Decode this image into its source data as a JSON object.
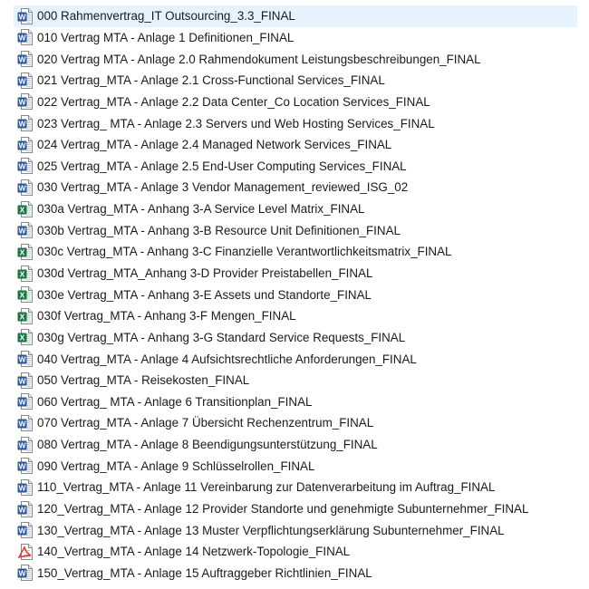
{
  "files": [
    {
      "name": "000 Rahmenvertrag_IT Outsourcing_3.3_FINAL",
      "type": "word",
      "icon": "word-document-icon",
      "selected": true
    },
    {
      "name": "010 Vertrag MTA - Anlage 1 Definitionen_FINAL",
      "type": "word",
      "icon": "word-document-icon"
    },
    {
      "name": "020 Vertrag MTA - Anlage 2.0 Rahmendokument Leistungsbeschreibungen_FINAL",
      "type": "word",
      "icon": "word-document-icon"
    },
    {
      "name": "021 Vertrag_MTA - Anlage 2.1 Cross-Functional Services_FINAL",
      "type": "word",
      "icon": "word-document-icon"
    },
    {
      "name": "022 Vertrag_MTA - Anlage 2.2 Data Center_Co Location Services_FINAL",
      "type": "word",
      "icon": "word-document-icon"
    },
    {
      "name": "023 Vertrag_ MTA - Anlage 2.3 Servers und Web Hosting Services_FINAL",
      "type": "word",
      "icon": "word-document-icon"
    },
    {
      "name": "024 Vertrag_MTA - Anlage 2.4 Managed Network Services_FINAL",
      "type": "word",
      "icon": "word-document-icon"
    },
    {
      "name": "025 Vertrag_MTA - Anlage 2.5 End-User Computing Services_FINAL",
      "type": "word",
      "icon": "word-document-icon"
    },
    {
      "name": "030 Vertrag_MTA - Anlage 3 Vendor Management_reviewed_ISG_02",
      "type": "word",
      "icon": "word-document-icon"
    },
    {
      "name": "030a Vertrag_MTA - Anhang 3-A Service Level Matrix_FINAL",
      "type": "excel",
      "icon": "excel-spreadsheet-icon"
    },
    {
      "name": "030b Vertrag_MTA - Anhang 3-B Resource Unit Definitionen_FINAL",
      "type": "word",
      "icon": "word-document-icon"
    },
    {
      "name": "030c Vertrag_MTA - Anhang 3-C Finanzielle Verantwortlichkeitsmatrix_FINAL",
      "type": "excel",
      "icon": "excel-spreadsheet-icon"
    },
    {
      "name": "030d Vertrag_MTA_Anhang 3-D Provider Preistabellen_FINAL",
      "type": "excel",
      "icon": "excel-spreadsheet-icon"
    },
    {
      "name": "030e Vertrag_MTA - Anhang 3-E Assets und Standorte_FINAL",
      "type": "excel",
      "icon": "excel-spreadsheet-icon"
    },
    {
      "name": "030f Vertrag_MTA - Anhang 3-F Mengen_FINAL",
      "type": "excel",
      "icon": "excel-spreadsheet-icon"
    },
    {
      "name": "030g Vertrag_MTA - Anhang 3-G Standard Service Requests_FINAL",
      "type": "excel",
      "icon": "excel-spreadsheet-icon"
    },
    {
      "name": "040 Vertrag_MTA - Anlage 4 Aufsichtsrechtliche Anforderungen_FINAL",
      "type": "word",
      "icon": "word-document-icon"
    },
    {
      "name": "050 Vertrag_MTA - Reisekosten_FINAL",
      "type": "word",
      "icon": "word-document-icon"
    },
    {
      "name": "060 Vertrag_ MTA - Anlage 6 Transitionplan_FINAL",
      "type": "word",
      "icon": "word-document-icon"
    },
    {
      "name": "070 Vertrag_MTA - Anlage 7 Übersicht Rechenzentrum_FINAL",
      "type": "word",
      "icon": "word-document-icon"
    },
    {
      "name": "080 Vertrag_MTA - Anlage 8 Beendigungsunterstützung_FINAL",
      "type": "word",
      "icon": "word-document-icon"
    },
    {
      "name": "090 Vertrag_MTA - Anlage 9 Schlüsselrollen_FINAL",
      "type": "word",
      "icon": "word-document-icon"
    },
    {
      "name": "110_Vertrag_MTA - Anlage 11 Vereinbarung zur Datenverarbeitung im Auftrag_FINAL",
      "type": "word",
      "icon": "word-document-icon"
    },
    {
      "name": "120_Vertrag_MTA - Anlage 12 Provider Standorte und genehmigte Subunternehmer_FINAL",
      "type": "word",
      "icon": "word-document-icon"
    },
    {
      "name": "130_Vertrag_MTA - Anlage 13 Muster Verpflichtungserklärung Subunternehmer_FINAL",
      "type": "word",
      "icon": "word-document-icon"
    },
    {
      "name": "140_Vertrag_MTA - Anlage 14 Netzwerk-Topologie_FINAL",
      "type": "pdf",
      "icon": "pdf-document-icon"
    },
    {
      "name": "150_Vertrag_MTA - Anlage 15 Auftraggeber Richtlinien_FINAL",
      "type": "word",
      "icon": "word-document-icon"
    }
  ],
  "colors": {
    "selection": "#e5f3ff",
    "word": "#2b5797",
    "excel": "#1f7244",
    "pdf": "#d9302c"
  }
}
